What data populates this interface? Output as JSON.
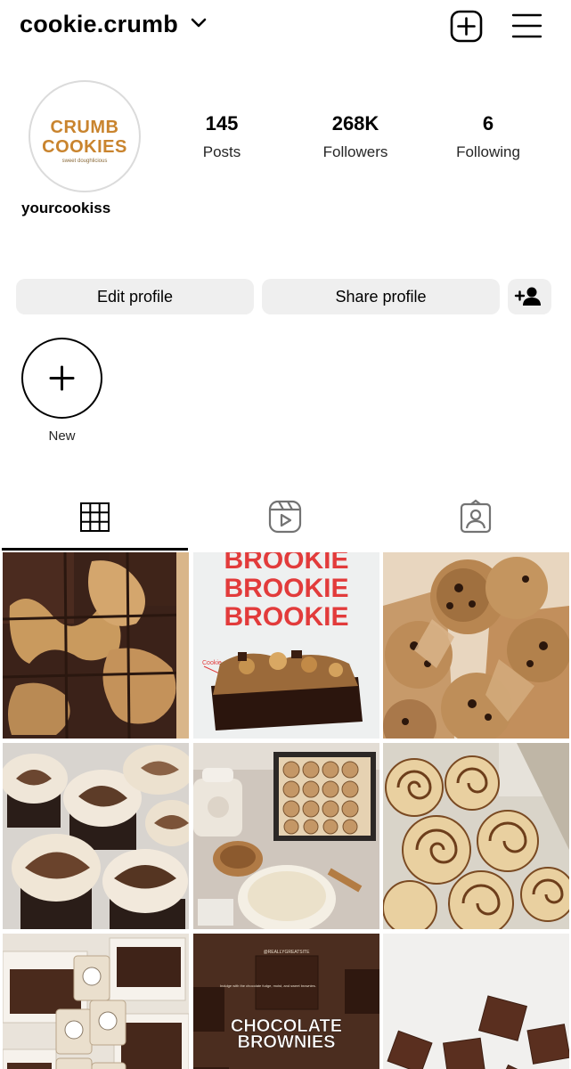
{
  "header": {
    "username": "cookie.crumb",
    "chevron_icon": "chevron-down-icon",
    "create_icon": "plus-square-icon",
    "menu_icon": "hamburger-menu-icon"
  },
  "profile": {
    "avatar_logo_line1": "CRUMB",
    "avatar_logo_line2": "COOKIES",
    "avatar_logo_sub": "sweet doughlicious",
    "handle": "yourcookiss",
    "stats": [
      {
        "value": "145",
        "label": "Posts"
      },
      {
        "value": "268K",
        "label": "Followers"
      },
      {
        "value": "6",
        "label": "Following"
      }
    ]
  },
  "actions": {
    "edit_label": "Edit profile",
    "share_label": "Share profile",
    "discover_icon": "add-person-icon"
  },
  "highlights": {
    "new_label": "New",
    "new_icon": "plus-icon"
  },
  "tabs": [
    {
      "name": "posts",
      "icon": "grid-icon",
      "active": true
    },
    {
      "name": "reels",
      "icon": "reels-icon",
      "active": false
    },
    {
      "name": "tagged",
      "icon": "tagged-person-icon",
      "active": false
    }
  ],
  "posts": [
    {
      "kind": "photo",
      "subject": "brookie bars"
    },
    {
      "kind": "graphic",
      "headline": [
        "BROOKIE",
        "BROOKIE",
        "BROOKIE"
      ],
      "caption": "Cookie"
    },
    {
      "kind": "photo",
      "subject": "chocolate chip cookies in paper"
    },
    {
      "kind": "photo",
      "subject": "swirl cupcakes"
    },
    {
      "kind": "photo",
      "subject": "cinnamon rolls baking"
    },
    {
      "kind": "photo",
      "subject": "glazed cinnamon rolls"
    },
    {
      "kind": "photo",
      "subject": "brownie boxes"
    },
    {
      "kind": "graphic",
      "headline": [
        "CHOCOLATE",
        "BROWNIES"
      ],
      "caption": "@REALLYGREATSITE",
      "note": "Indulge with the chocolate fudge, moist, and sweet brownies."
    },
    {
      "kind": "photo",
      "subject": "brownie squares"
    }
  ],
  "colors": {
    "button_bg": "#efefef",
    "text": "#000000",
    "brand_orange": "#c9842e",
    "brookie_red": "#e23b3b"
  }
}
